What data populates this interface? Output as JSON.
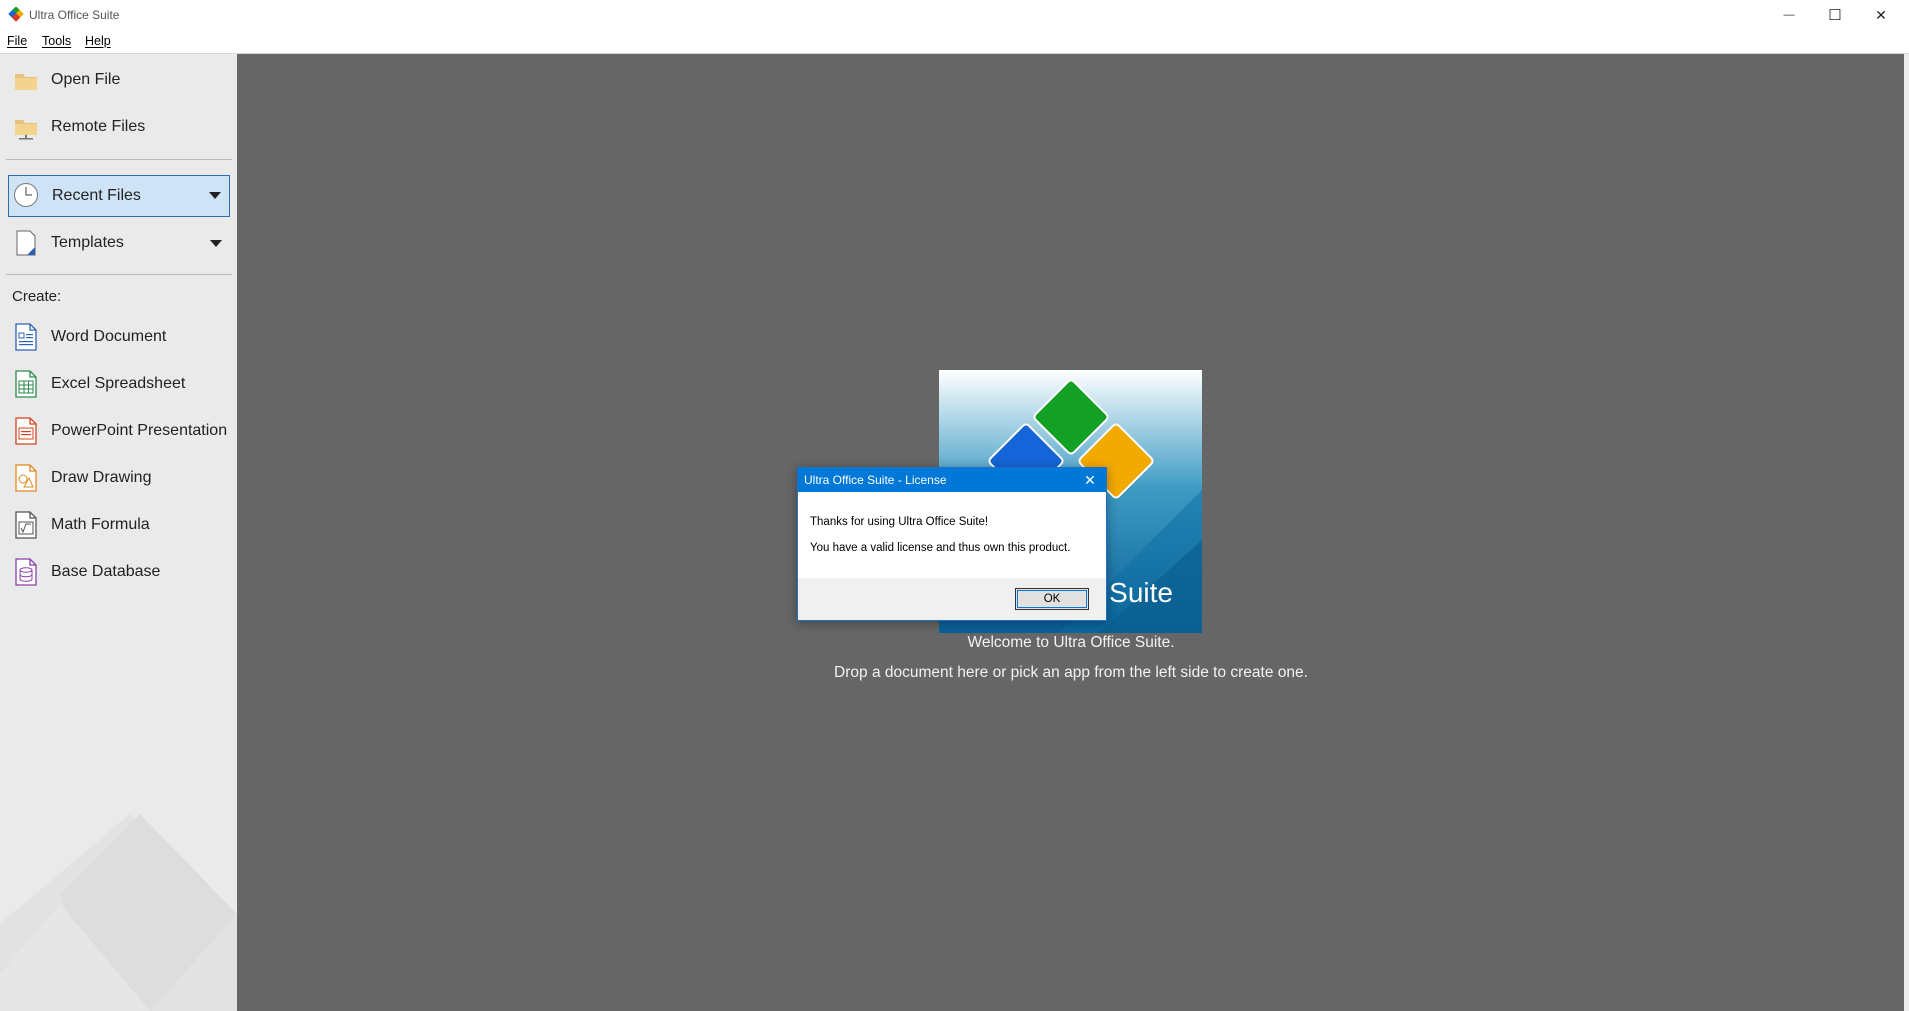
{
  "window": {
    "title": "Ultra Office Suite"
  },
  "window_controls": {
    "minimize": "—",
    "maximize": "☐",
    "close": "✕"
  },
  "menu": {
    "file": "File",
    "tools": "Tools",
    "help": "Help"
  },
  "sidebar": {
    "open_file": "Open File",
    "remote_files": "Remote Files",
    "recent_files": "Recent Files",
    "templates": "Templates",
    "create_label": "Create:",
    "create_items": [
      {
        "label": "Word Document",
        "color": "#2b63b4"
      },
      {
        "label": "Excel Spreadsheet",
        "color": "#2a8a4a"
      },
      {
        "label": "PowerPoint Presentation",
        "color": "#d0441e"
      },
      {
        "label": "Draw Drawing",
        "color": "#e08a1e"
      },
      {
        "label": "Math Formula",
        "color": "#555555"
      },
      {
        "label": "Base Database",
        "color": "#8a3fa8"
      }
    ]
  },
  "main": {
    "splash_text": "e Suite",
    "welcome": "Welcome to Ultra Office Suite.",
    "drop_hint": "Drop a document here or pick an app from the left side to create one."
  },
  "dialog": {
    "title": "Ultra Office Suite - License",
    "close_glyph": "✕",
    "line1": "Thanks for using Ultra Office Suite!",
    "line2": "You have a valid license and thus own this product.",
    "ok_label": "OK"
  },
  "colors": {
    "accent": "#0078d7",
    "main_bg": "#666666",
    "sidebar_bg": "#eaeaea",
    "selection_bg": "#cfe3f7"
  }
}
